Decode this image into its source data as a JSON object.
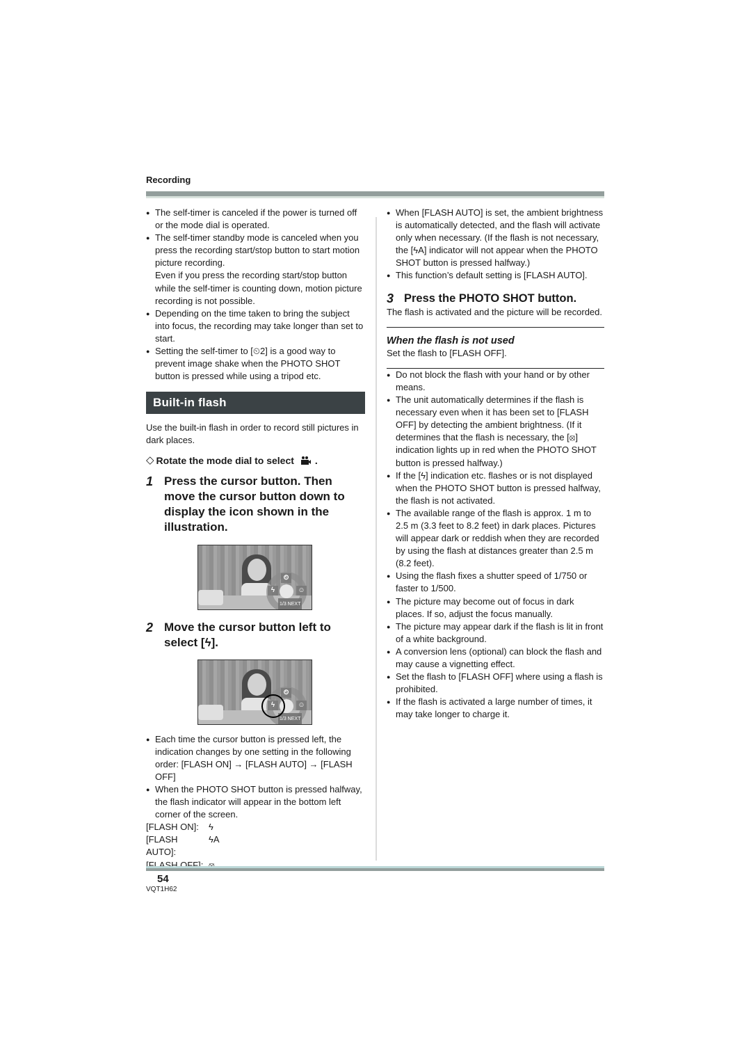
{
  "header": {
    "section": "Recording"
  },
  "footer": {
    "page_number": "54",
    "document_code": "VQT1H62"
  },
  "left_column": {
    "bullets_top": [
      {
        "text": "The self-timer is canceled if the power is turned off or the mode dial is operated."
      },
      {
        "text": "The self-timer standby mode is canceled when you press the recording start/stop button to start motion picture recording.",
        "continuation": "Even if you press the recording start/stop button while the self-timer is counting down, motion picture recording is not possible."
      },
      {
        "text": "Depending on the time taken to bring the subject into focus, the recording may take longer than set to start."
      },
      {
        "text": "Setting the self-timer to [⏲2] is a good way to prevent image shake when the PHOTO SHOT button is pressed while using a tripod etc."
      }
    ],
    "section_title": "Built-in flash",
    "intro": "Use the built-in flash in order to record still pictures in dark places.",
    "prerequisite": {
      "symbol": "◇",
      "text": "Rotate the mode dial to select",
      "icon": "camera-mode-icon",
      "suffix": "."
    },
    "step1": {
      "number": "1",
      "text": "Press the cursor button. Then move the cursor button down to display the icon shown in the illustration."
    },
    "illustration1": {
      "icons": {
        "top": "⏲",
        "left": "ϟ",
        "right": "☺"
      },
      "label": "1/3 NEXT"
    },
    "step2": {
      "number": "2",
      "text": "Move the cursor button left to select [ϟ]."
    },
    "illustration2": {
      "icons": {
        "top": "⏲",
        "left": "ϟ",
        "right": "☺"
      },
      "label": "1/3 NEXT"
    },
    "bullets_bottom": [
      {
        "text": "Each time the cursor button is pressed left, the indication changes by one setting in the following order: [FLASH ON] → [FLASH AUTO] → [FLASH OFF]"
      },
      {
        "text": "When the PHOTO SHOT button is pressed halfway, the flash indicator will appear in the bottom left corner of the screen."
      }
    ],
    "flash_modes": [
      {
        "label": "[FLASH ON]:",
        "icon": "ϟ"
      },
      {
        "label": "[FLASH AUTO]:",
        "icon": "ϟA"
      },
      {
        "label": "[FLASH OFF]:",
        "icon": "⦻"
      }
    ]
  },
  "right_column": {
    "bullets_top": [
      {
        "text": "When [FLASH AUTO] is set, the ambient brightness is automatically detected, and the flash will activate only when necessary. (If the flash is not necessary, the [ϟA] indicator will not appear when the PHOTO SHOT button is pressed halfway.)"
      },
      {
        "text": "This function’s default setting is [FLASH AUTO]."
      }
    ],
    "step3": {
      "number": "3",
      "text": "Press the PHOTO SHOT button.",
      "description": "The flash is activated and the picture will be recorded."
    },
    "note": {
      "title": "When the flash is not used",
      "text": "Set the flash to [FLASH OFF]."
    },
    "bullets_bottom": [
      {
        "text": "Do not block the flash with your hand or by other means."
      },
      {
        "text": "The unit automatically determines if the flash is necessary even when it has been set to [FLASH OFF] by detecting the ambient brightness. (If it determines that the flash is necessary, the [⦻] indication lights up in red when the PHOTO SHOT button is pressed halfway.)"
      },
      {
        "text": "If the [ϟ] indication etc. flashes or is not displayed when the PHOTO SHOT button is pressed halfway, the flash is not activated."
      },
      {
        "text": "The available range of the flash is approx. 1 m to 2.5 m (3.3 feet to 8.2 feet) in dark places. Pictures will appear dark or reddish when they are recorded by using the flash at distances greater than 2.5 m (8.2 feet)."
      },
      {
        "text": "Using the flash fixes a shutter speed of 1/750 or faster to 1/500."
      },
      {
        "text": "The picture may become out of focus in dark places. If so, adjust the focus manually."
      },
      {
        "text": "The picture may appear dark if the flash is lit in front of a white background."
      },
      {
        "text": "A conversion lens (optional) can block the flash and may cause a vignetting effect."
      },
      {
        "text": "Set the flash to [FLASH OFF] where using a flash is prohibited."
      },
      {
        "text": "If the flash is activated a large number of times, it may take longer to charge it."
      }
    ]
  }
}
